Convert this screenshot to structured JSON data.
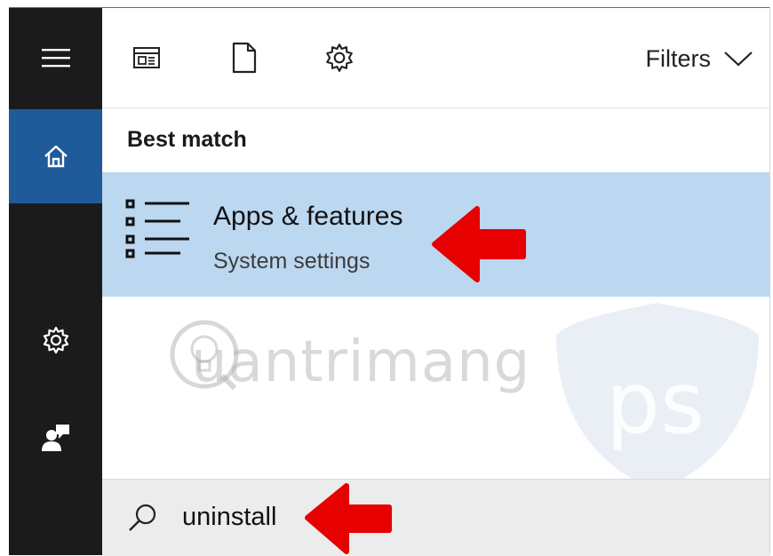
{
  "toolbar": {
    "icons": [
      "apps-icon",
      "documents-icon",
      "settings-icon"
    ],
    "filters_label": "Filters"
  },
  "rail": {
    "icons": [
      "hamburger-menu-icon",
      "home-icon",
      "settings-icon",
      "feedback-icon"
    ],
    "active": "home"
  },
  "results": {
    "section_title": "Best match",
    "best_match": {
      "title": "Apps & features",
      "subtitle": "System settings",
      "icon": "list-icon"
    }
  },
  "search": {
    "value": "uninstall",
    "icon": "search-icon"
  },
  "watermark": {
    "text": "uantrimang",
    "badge": "ps"
  },
  "colors": {
    "rail_bg": "#1b1b1b",
    "rail_active": "#1f5b9a",
    "highlight": "#bcd7f0",
    "search_bg": "#ececec",
    "annotation_arrow": "#e60000"
  }
}
